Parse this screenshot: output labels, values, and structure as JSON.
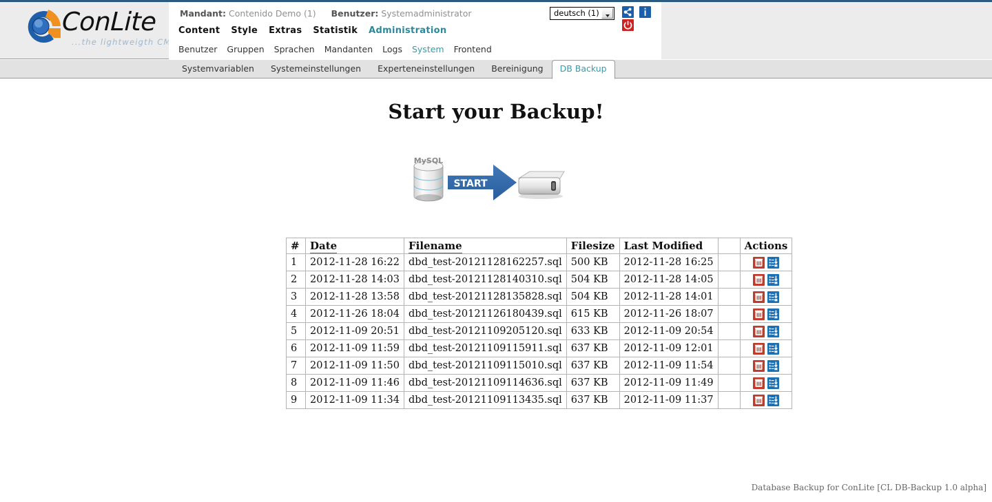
{
  "brand": {
    "name": "ConLite",
    "tagline": "...the lightweigth CMS",
    "logo_blue": "#1f5fa9",
    "logo_orange": "#f0901e"
  },
  "header": {
    "mandant_label": "Mandant:",
    "mandant_value": "Contenido Demo (1)",
    "benutzer_label": "Benutzer:",
    "benutzer_value": "Systemadministrator",
    "language_selected": "deutsch (1)",
    "icons": [
      {
        "name": "share-icon",
        "title": "Share"
      },
      {
        "name": "info-icon",
        "title": "Info"
      },
      {
        "name": "logout-power-icon",
        "title": "Logout"
      }
    ]
  },
  "mainnav": {
    "items": [
      {
        "label": "Content",
        "active": false
      },
      {
        "label": "Style",
        "active": false
      },
      {
        "label": "Extras",
        "active": false
      },
      {
        "label": "Statistik",
        "active": false
      },
      {
        "label": "Administration",
        "active": true
      }
    ]
  },
  "subnav": {
    "items": [
      {
        "label": "Benutzer",
        "active": false
      },
      {
        "label": "Gruppen",
        "active": false
      },
      {
        "label": "Sprachen",
        "active": false
      },
      {
        "label": "Mandanten",
        "active": false
      },
      {
        "label": "Logs",
        "active": false
      },
      {
        "label": "System",
        "active": true
      },
      {
        "label": "Frontend",
        "active": false
      }
    ]
  },
  "tabs": {
    "items": [
      {
        "label": "Systemvariablen",
        "active": false
      },
      {
        "label": "Systemeinstellungen",
        "active": false
      },
      {
        "label": "Experteneinstellungen",
        "active": false
      },
      {
        "label": "Bereinigung",
        "active": false
      },
      {
        "label": "DB Backup",
        "active": true
      }
    ]
  },
  "main": {
    "title": "Start your Backup!",
    "start_graphic": {
      "source_label": "MySQL",
      "action_label": "START",
      "target_label": "backup-drive"
    },
    "table": {
      "headers": [
        "#",
        "Date",
        "Filename",
        "Filesize",
        "Last Modified",
        "",
        "Actions"
      ],
      "sortable": [
        "Date",
        "Filename"
      ],
      "rows": [
        {
          "num": "1",
          "date": "2012-11-28 16:22",
          "filename": "dbd_test-20121128162257.sql",
          "filesize": "500 KB",
          "modified": "2012-11-28 16:25"
        },
        {
          "num": "2",
          "date": "2012-11-28 14:03",
          "filename": "dbd_test-20121128140310.sql",
          "filesize": "504 KB",
          "modified": "2012-11-28 14:05"
        },
        {
          "num": "3",
          "date": "2012-11-28 13:58",
          "filename": "dbd_test-20121128135828.sql",
          "filesize": "504 KB",
          "modified": "2012-11-28 14:01"
        },
        {
          "num": "4",
          "date": "2012-11-26 18:04",
          "filename": "dbd_test-20121126180439.sql",
          "filesize": "615 KB",
          "modified": "2012-11-26 18:07"
        },
        {
          "num": "5",
          "date": "2012-11-09 20:51",
          "filename": "dbd_test-20121109205120.sql",
          "filesize": "633 KB",
          "modified": "2012-11-09 20:54"
        },
        {
          "num": "6",
          "date": "2012-11-09 11:59",
          "filename": "dbd_test-20121109115911.sql",
          "filesize": "637 KB",
          "modified": "2012-11-09 12:01"
        },
        {
          "num": "7",
          "date": "2012-11-09 11:50",
          "filename": "dbd_test-20121109115010.sql",
          "filesize": "637 KB",
          "modified": "2012-11-09 11:54"
        },
        {
          "num": "8",
          "date": "2012-11-09 11:46",
          "filename": "dbd_test-20121109114636.sql",
          "filesize": "637 KB",
          "modified": "2012-11-09 11:49"
        },
        {
          "num": "9",
          "date": "2012-11-09 11:34",
          "filename": "dbd_test-20121109113435.sql",
          "filesize": "637 KB",
          "modified": "2012-11-09 11:37"
        }
      ],
      "row_actions": [
        {
          "name": "delete-backup-icon",
          "title": "Delete"
        },
        {
          "name": "download-backup-icon",
          "title": "Download"
        }
      ]
    }
  },
  "footer": {
    "text": "Database Backup for ConLite [CL DB-Backup 1.0 alpha]"
  }
}
